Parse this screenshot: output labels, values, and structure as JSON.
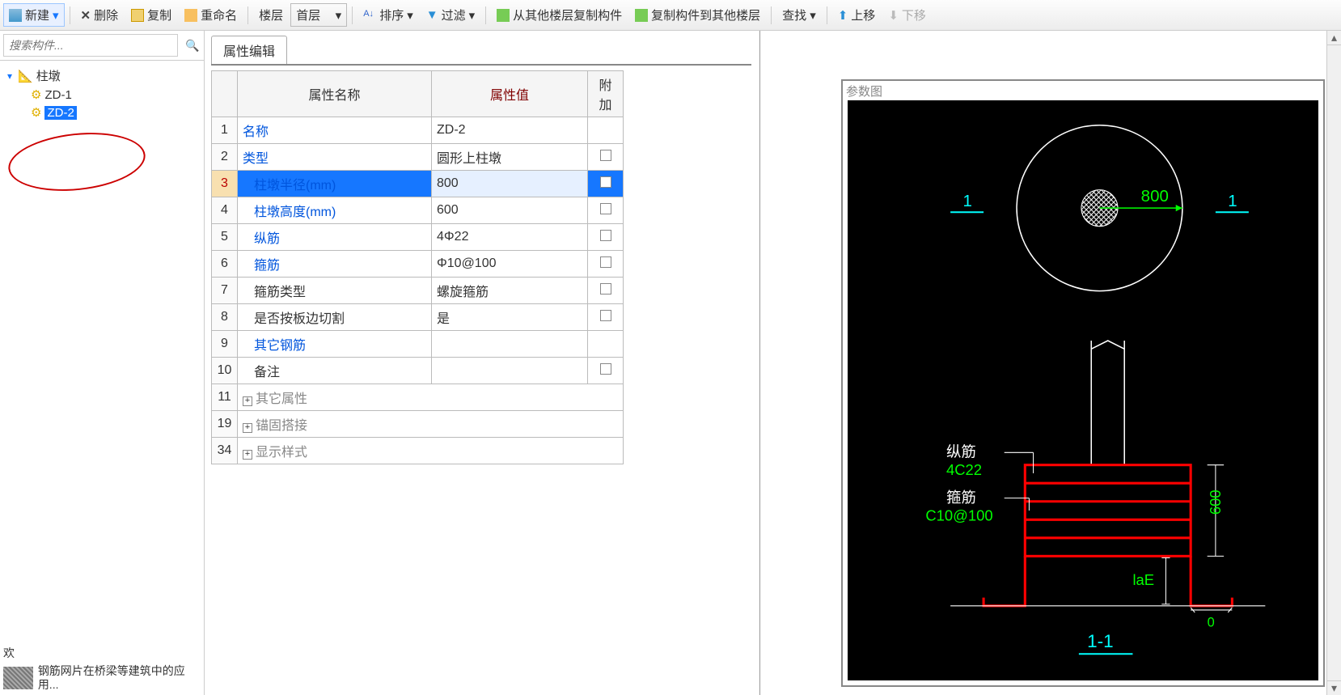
{
  "toolbar": {
    "new_label": "新建",
    "delete_label": "删除",
    "copy_label": "复制",
    "rename_label": "重命名",
    "floor_label": "楼层",
    "first_floor_label": "首层",
    "sort_label": "排序",
    "filter_label": "过滤",
    "copy_from_other_label": "从其他楼层复制构件",
    "copy_to_other_label": "复制构件到其他楼层",
    "find_label": "查找",
    "move_up_label": "上移",
    "move_down_label": "下移"
  },
  "search": {
    "placeholder": "搜索构件..."
  },
  "tree": {
    "root": "柱墩",
    "items": [
      "ZD-1",
      "ZD-2"
    ],
    "selected_index": 1
  },
  "footer": {
    "line1": "欢",
    "news_text": "钢筋网片在桥梁等建筑中的应用..."
  },
  "tab_title": "属性编辑",
  "prop_headers": {
    "name": "属性名称",
    "value": "属性值",
    "attach": "附加"
  },
  "rows": [
    {
      "n": "1",
      "name": "名称",
      "link": true,
      "value": "ZD-2",
      "chk": false
    },
    {
      "n": "2",
      "name": "类型",
      "link": true,
      "value": "圆形上柱墩",
      "chk": true
    },
    {
      "n": "3",
      "name": "柱墩半径(mm)",
      "link": true,
      "indent": true,
      "value": "800",
      "chk": true,
      "selected": true
    },
    {
      "n": "4",
      "name": "柱墩高度(mm)",
      "link": true,
      "indent": true,
      "value": "600",
      "chk": true
    },
    {
      "n": "5",
      "name": "纵筋",
      "link": true,
      "indent": true,
      "value": "4Φ22",
      "chk": true
    },
    {
      "n": "6",
      "name": "箍筋",
      "link": true,
      "indent": true,
      "value": "Φ10@100",
      "chk": true
    },
    {
      "n": "7",
      "name": "箍筋类型",
      "link": false,
      "indent": true,
      "value": "螺旋箍筋",
      "chk": true
    },
    {
      "n": "8",
      "name": "是否按板边切割",
      "link": false,
      "indent": true,
      "value": "是",
      "chk": true
    },
    {
      "n": "9",
      "name": "其它钢筋",
      "link": true,
      "indent": true,
      "value": "",
      "chk": false
    },
    {
      "n": "10",
      "name": "备注",
      "link": false,
      "indent": true,
      "value": "",
      "chk": true
    }
  ],
  "groups": [
    {
      "n": "11",
      "label": "其它属性"
    },
    {
      "n": "19",
      "label": "锚固搭接"
    },
    {
      "n": "34",
      "label": "显示样式"
    }
  ],
  "diagram": {
    "title": "参数图",
    "radius_label": "800",
    "section_mark": "1",
    "zongjin_label": "纵筋",
    "zongjin_val": "4C22",
    "gujin_label": "箍筋",
    "gujin_val": "C10@100",
    "height_label": "600",
    "la_label": "laE",
    "zero_label": "0",
    "section_name": "1-1"
  }
}
